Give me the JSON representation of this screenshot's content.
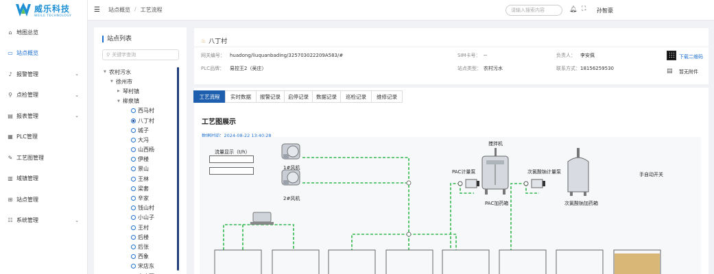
{
  "brand": {
    "cn": "威乐科技",
    "en": "WEILE TECHNOLOGY"
  },
  "sidebar": {
    "items": [
      {
        "label": "地图总览",
        "icon": "home-icon",
        "has_children": false,
        "active": false
      },
      {
        "label": "站点概览",
        "icon": "monitor-icon",
        "has_children": false,
        "active": true
      },
      {
        "label": "报警管理",
        "icon": "bell-icon",
        "has_children": true,
        "active": false
      },
      {
        "label": "点检管理",
        "icon": "pin-icon",
        "has_children": true,
        "active": false
      },
      {
        "label": "报表管理",
        "icon": "report-icon",
        "has_children": true,
        "active": false
      },
      {
        "label": "PLC管理",
        "icon": "chip-icon",
        "has_children": false,
        "active": false
      },
      {
        "label": "工艺图管理",
        "icon": "edit-icon",
        "has_children": false,
        "active": false
      },
      {
        "label": "域镇管理",
        "icon": "domain-icon",
        "has_children": false,
        "active": false
      },
      {
        "label": "站点管理",
        "icon": "station-icon",
        "has_children": false,
        "active": false
      },
      {
        "label": "系统管理",
        "icon": "settings-icon",
        "has_children": true,
        "active": false
      }
    ]
  },
  "topbar": {
    "breadcrumb": [
      "站点概览",
      "工艺流程"
    ],
    "search_placeholder": "请输入搜索内容",
    "user": "孙智豪"
  },
  "station_list": {
    "title": "站点列表",
    "search_placeholder": "关键字查询",
    "tree": [
      {
        "label": "农村污水",
        "level": 0,
        "type": "group",
        "expanded": true
      },
      {
        "label": "徐州市",
        "level": 1,
        "type": "group",
        "expanded": true
      },
      {
        "label": "琴村镇",
        "level": 2,
        "type": "group",
        "expanded": false
      },
      {
        "label": "柳泉镇",
        "level": 2,
        "type": "group",
        "expanded": true
      },
      {
        "label": "西马村",
        "level": 3,
        "type": "leaf",
        "selected": false
      },
      {
        "label": "八丁村",
        "level": 3,
        "type": "leaf",
        "selected": true
      },
      {
        "label": "城子",
        "level": 3,
        "type": "leaf",
        "selected": false
      },
      {
        "label": "大冯",
        "level": 3,
        "type": "leaf",
        "selected": false
      },
      {
        "label": "山西杨",
        "level": 3,
        "type": "leaf",
        "selected": false
      },
      {
        "label": "伊楼",
        "level": 3,
        "type": "leaf",
        "selected": false
      },
      {
        "label": "景山",
        "level": 3,
        "type": "leaf",
        "selected": false
      },
      {
        "label": "王林",
        "level": 3,
        "type": "leaf",
        "selected": false
      },
      {
        "label": "梁套",
        "level": 3,
        "type": "leaf",
        "selected": false
      },
      {
        "label": "辛家",
        "level": 3,
        "type": "leaf",
        "selected": false
      },
      {
        "label": "钱山村",
        "level": 3,
        "type": "leaf",
        "selected": false
      },
      {
        "label": "小山子",
        "level": 3,
        "type": "leaf",
        "selected": false
      },
      {
        "label": "王村",
        "level": 3,
        "type": "leaf",
        "selected": false
      },
      {
        "label": "后楼",
        "level": 3,
        "type": "leaf",
        "selected": false
      },
      {
        "label": "后张",
        "level": 3,
        "type": "leaf",
        "selected": false
      },
      {
        "label": "西象",
        "level": 3,
        "type": "leaf",
        "selected": false
      },
      {
        "label": "宋店东",
        "level": 3,
        "type": "leaf",
        "selected": false
      },
      {
        "label": "宋店西",
        "level": 3,
        "type": "leaf",
        "selected": false
      }
    ]
  },
  "station_info": {
    "name": "八丁村",
    "gateway_label": "网关编号：",
    "gateway": "huadong/liuquanbading/325703022209A583/#",
    "sim_label": "SIM卡号：",
    "sim": "--",
    "owner_label": "负责人：",
    "owner": "李安佩",
    "plc_label": "PLC品牌：",
    "plc": "易控王2（吴庄）",
    "type_label": "站点类型：",
    "type": "农村污水",
    "phone_label": "联系方式：",
    "phone": "18156259530",
    "qr_label": "下载二维码",
    "attach_label": "暂无附件"
  },
  "tabs": [
    "工艺流程",
    "实时数据",
    "报警记录",
    "启停记录",
    "数据记录",
    "巡检记录",
    "维修记录"
  ],
  "active_tab": "工艺流程",
  "process": {
    "title": "工艺图展示",
    "data_time": "数据时间：2024-08-22 13:40:28",
    "flow_label": "流量显示（t/h）",
    "fan1": "1#风机",
    "fan2": "2#风机",
    "mixer": "搅拌机",
    "pac_pump": "PAC计量泵",
    "pac_tank": "PAC加药箱",
    "naclo_pump": "次氯酸钠计量泵",
    "naclo_tank": "次氯酸钠加药箱",
    "switch": "手自动开关",
    "pipe_color": "#2fb84c"
  }
}
